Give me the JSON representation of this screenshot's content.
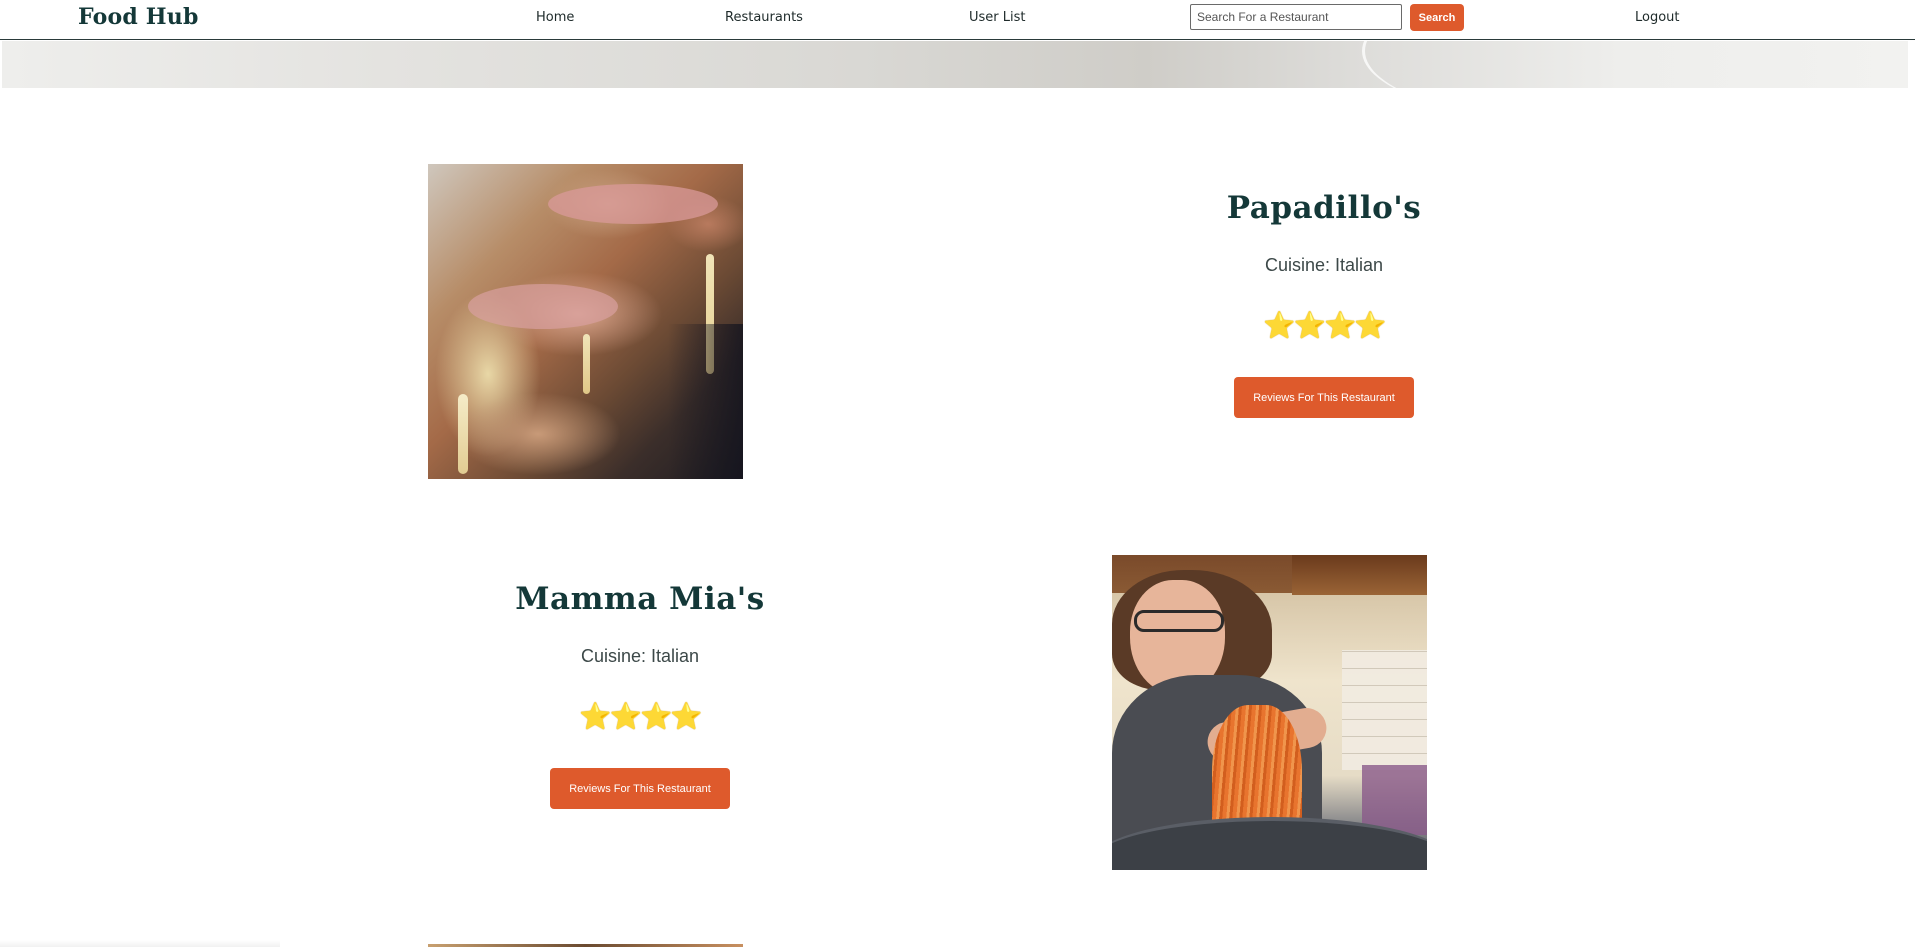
{
  "navbar": {
    "brand": "Food Hub",
    "links": {
      "home": "Home",
      "restaurants": "Restaurants",
      "user_list": "User List",
      "logout": "Logout"
    },
    "search": {
      "placeholder": "Search For a Restaurant",
      "value": "",
      "button_label": "Search"
    }
  },
  "colors": {
    "brand_text": "#143838",
    "accent": "#de5a2c",
    "star": "#f4c234"
  },
  "restaurants": [
    {
      "name": "Papadillo's",
      "cuisine_label": "Cuisine:",
      "cuisine": "Italian",
      "rating_stars": 4,
      "rating_glyphs": "⭐⭐⭐⭐",
      "reviews_button": "Reviews For This Restaurant",
      "image": "stromboli-photo"
    },
    {
      "name": "Mamma Mia's",
      "cuisine_label": "Cuisine:",
      "cuisine": "Italian",
      "rating_stars": 4,
      "rating_glyphs": "⭐⭐⭐⭐",
      "reviews_button": "Reviews For This Restaurant",
      "image": "woman-with-pasta-photo"
    }
  ]
}
